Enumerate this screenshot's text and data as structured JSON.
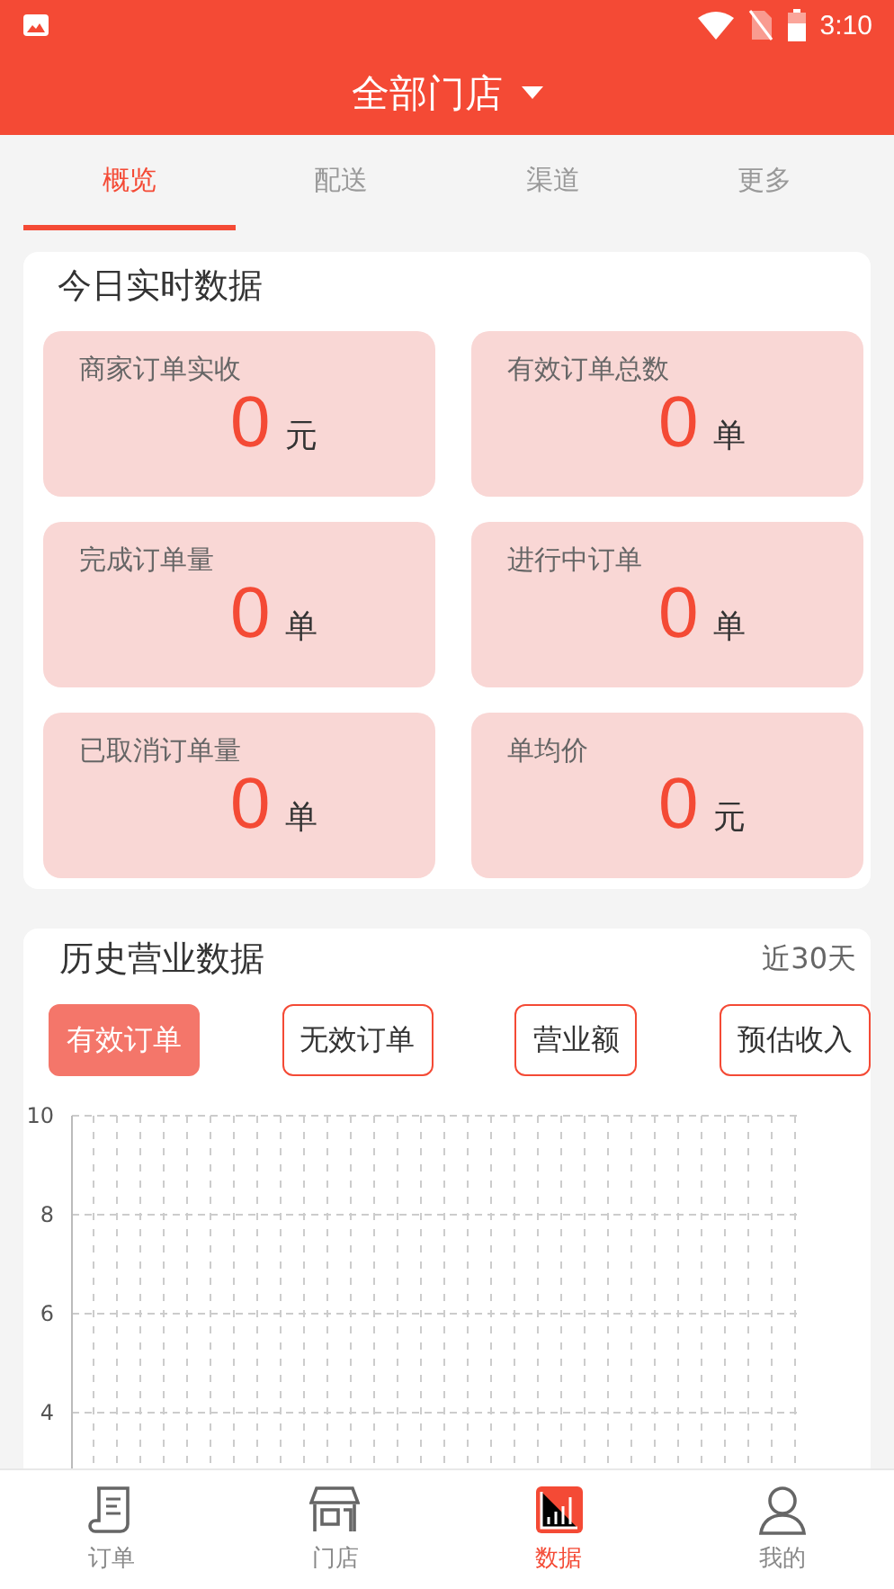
{
  "status_bar": {
    "time": "3:10"
  },
  "header": {
    "title": "全部门店"
  },
  "tabs": [
    {
      "label": "概览",
      "selected": true
    },
    {
      "label": "配送",
      "selected": false
    },
    {
      "label": "渠道",
      "selected": false
    },
    {
      "label": "更多",
      "selected": false
    }
  ],
  "realtime": {
    "title": "今日实时数据",
    "stats": [
      {
        "label": "商家订单实收",
        "value": "0",
        "unit": "元"
      },
      {
        "label": "有效订单总数",
        "value": "0",
        "unit": "单"
      },
      {
        "label": "完成订单量",
        "value": "0",
        "unit": "单"
      },
      {
        "label": "进行中订单",
        "value": "0",
        "unit": "单"
      },
      {
        "label": "已取消订单量",
        "value": "0",
        "unit": "单"
      },
      {
        "label": "单均价",
        "value": "0",
        "unit": "元"
      }
    ]
  },
  "history": {
    "title": "历史营业数据",
    "range": "近30天",
    "filters": [
      {
        "label": "有效订单",
        "selected": true
      },
      {
        "label": "无效订单",
        "selected": false
      },
      {
        "label": "营业额",
        "selected": false
      },
      {
        "label": "预估收入",
        "selected": false
      }
    ],
    "chart": {
      "y_axis_labels": [
        "10",
        "8",
        "6",
        "4"
      ]
    }
  },
  "bottom_nav": [
    {
      "label": "订单",
      "kind": "order",
      "selected": false
    },
    {
      "label": "门店",
      "kind": "store",
      "selected": false
    },
    {
      "label": "数据",
      "kind": "data",
      "selected": true
    },
    {
      "label": "我的",
      "kind": "me",
      "selected": false
    }
  ]
}
